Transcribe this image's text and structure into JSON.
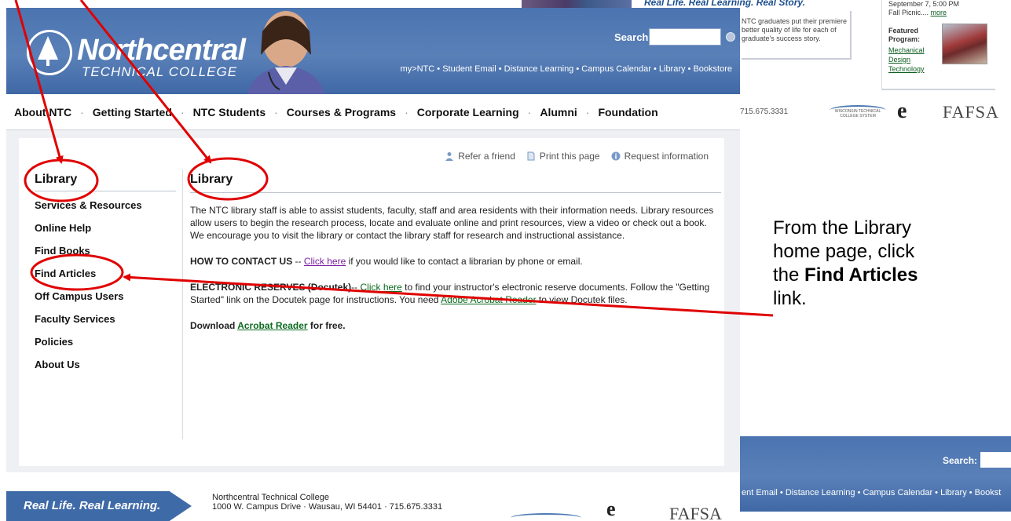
{
  "bg_top": {
    "spotlight_title": "Real Life. Real Learning. Real Story.",
    "spotlight_text": "NTC graduates put their premiere better quality of life for each of graduate's success story.",
    "news_line1": "September 7, 5:00 PM",
    "news_line2": "Fall Picnic....",
    "news_more": "more",
    "featured_label": "Featured Program:",
    "featured_program": "Mechanical Design Technology"
  },
  "header": {
    "brand": "Northcentral",
    "brand_sub": "TECHNICAL COLLEGE",
    "search_label": "Search:",
    "search_value": "",
    "toplinks": "my>NTC • Student Email • Distance Learning • Campus Calendar • Library • Bookstore"
  },
  "nav": {
    "items": [
      "About NTC",
      "Getting Started",
      "NTC Students",
      "Courses & Programs",
      "Corporate Learning",
      "Alumni",
      "Foundation"
    ]
  },
  "right_strip": {
    "phone": "715.675.3331",
    "wtcs": "WISCONSIN TECHNICAL COLLEGE SYSTEM",
    "etech": "e",
    "fafsa": "FAFSA"
  },
  "utility": {
    "refer": "Refer a friend",
    "print": "Print this page",
    "request": "Request information"
  },
  "sidebar": {
    "title": "Library",
    "items": [
      "Services & Resources",
      "Online Help",
      "Find Books",
      "Find Articles",
      "Off Campus Users",
      "Faculty Services",
      "Policies",
      "About Us"
    ]
  },
  "main": {
    "title": "Library",
    "intro": "The NTC library staff is able to assist students, faculty, staff and area residents with their information needs. Library resources allow users to begin the research process, locate and evaluate online and print resources, view a video or check out a book. We encourage you to visit the library or contact the library staff for research and instructional assistance.",
    "contact_label": "HOW TO CONTACT US",
    "contact_sep": " -- ",
    "contact_link": "Click here",
    "contact_rest": " if you would like to contact a librarian by phone or email.",
    "reserves_label": "ELECTRONIC RESERVES (Docutek)",
    "reserves_sep": "-- ",
    "reserves_link": "Click here",
    "reserves_rest1": " to find your instructor's electronic reserve documents. Follow the \"Getting Started\" link on the Docutek page for instructions. You need ",
    "reserves_link2": "Adobe Acrobat Reader",
    "reserves_rest2": " to view Docutek files.",
    "download_pre": "Download ",
    "download_link": "Acrobat Reader",
    "download_post": " for free."
  },
  "footer": {
    "tagline": "Real Life. Real Learning.",
    "addr1": "Northcentral Technical College",
    "addr2": "1000 W. Campus Drive · Wausau, WI 54401 · 715.675.3331",
    "etech": "e",
    "fafsa": "FAFSA"
  },
  "header_copy": {
    "search_label": "Search:",
    "links": "ent Email • Distance Learning • Campus Calendar • Library • Bookst"
  },
  "instruction": {
    "pre": "From the Library home page, click the ",
    "bold": "Find Articles",
    "post": " link."
  },
  "colors": {
    "header_blue": "#4b74b0",
    "annotation_red": "#e00000",
    "link_green": "#0b6b1f"
  }
}
